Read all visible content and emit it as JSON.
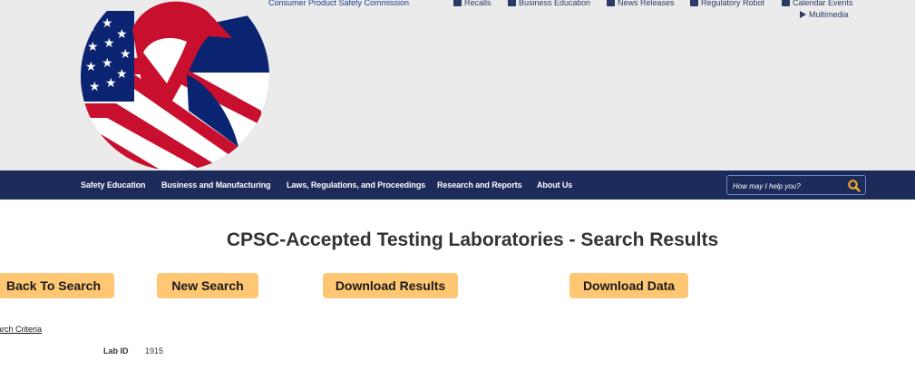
{
  "header": {
    "agency_name": "Consumer Product Safety Commission",
    "utility_links": [
      {
        "label": "Recalls",
        "icon": "megaphone-icon"
      },
      {
        "label": "Business Education",
        "icon": "briefcase-icon"
      },
      {
        "label": "News Releases",
        "icon": "newspaper-icon"
      },
      {
        "label": "Regulatory Robot",
        "icon": "robot-icon"
      },
      {
        "label": "Calendar Events",
        "icon": "calendar-icon"
      },
      {
        "label": "Multimedia",
        "icon": "play-icon"
      }
    ]
  },
  "nav": {
    "items": [
      "Safety Education",
      "Business and Manufacturing",
      "Laws, Regulations, and Proceedings",
      "Research and Reports",
      "About Us"
    ],
    "search_placeholder": "How may I help you?"
  },
  "main": {
    "title": "CPSC-Accepted Testing Laboratories - Search Results",
    "buttons": {
      "back": "Back To Search",
      "new": "New Search",
      "download_results": "Download Results",
      "download_data": "Download Data"
    },
    "criteria_link": "earch Criteria",
    "lab_id_label": "Lab ID",
    "lab_id_value": "1915"
  },
  "colors": {
    "header_bg": "#ebebeb",
    "nav_bg": "#1c2b5a",
    "button_bg": "#ffc673",
    "logo_red": "#c8102e",
    "logo_blue": "#0a2472",
    "search_icon": "#f5a623"
  }
}
